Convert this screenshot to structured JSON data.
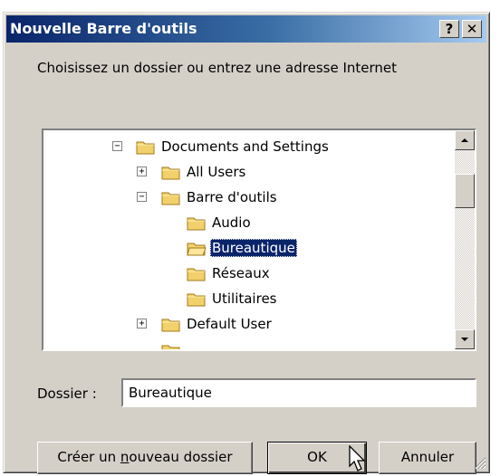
{
  "window": {
    "title": "Nouvelle Barre d'outils",
    "help_label": "?",
    "close_label": "✕"
  },
  "prompt": "Choisissez un dossier ou entrez une adresse Internet",
  "tree": {
    "items": [
      {
        "label": "Documents and Settings",
        "expander": "−",
        "selected": false
      },
      {
        "label": "All Users",
        "expander": "+",
        "selected": false
      },
      {
        "label": "Barre d'outils",
        "expander": "−",
        "selected": false
      },
      {
        "label": "Audio",
        "expander": "",
        "selected": false
      },
      {
        "label": "Bureautique",
        "expander": "",
        "selected": true
      },
      {
        "label": "Réseaux",
        "expander": "",
        "selected": false
      },
      {
        "label": "Utilitaires",
        "expander": "",
        "selected": false
      },
      {
        "label": "Default User",
        "expander": "+",
        "selected": false
      }
    ]
  },
  "folder_field": {
    "label": "Dossier :",
    "value": "Bureautique"
  },
  "buttons": {
    "new_folder_pre": "Créer un ",
    "new_folder_mnemonic": "n",
    "new_folder_post": "ouveau dossier",
    "ok": "OK",
    "cancel": "Annuler"
  },
  "colors": {
    "title_start": "#0a246a",
    "title_end": "#a6caf0",
    "dialog_bg": "#d4d0c8",
    "selection": "#0a246a",
    "folder": "#f2d06b"
  }
}
